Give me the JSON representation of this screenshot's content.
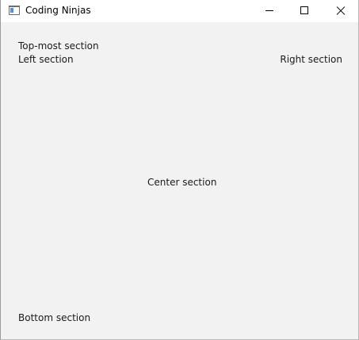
{
  "window": {
    "title": "Coding Ninjas",
    "icon": "window-app-icon",
    "controls": {
      "minimize_icon": "minimize-icon",
      "maximize_icon": "maximize-icon",
      "close_icon": "close-icon"
    }
  },
  "sections": {
    "top": "Top-most section",
    "left": "Left section",
    "right": "Right section",
    "center": "Center section",
    "bottom": "Bottom section"
  }
}
